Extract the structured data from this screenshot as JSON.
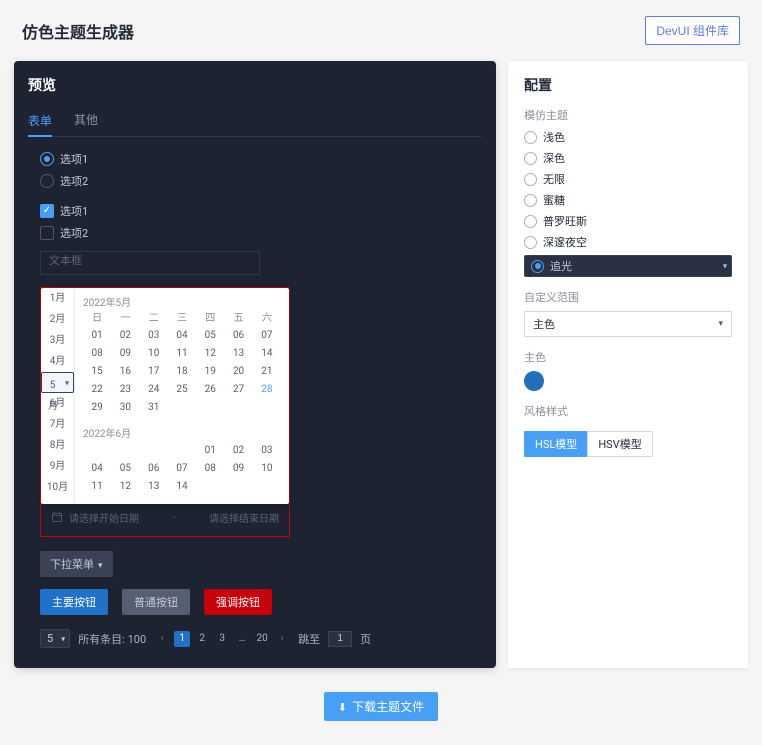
{
  "header": {
    "title": "仿色主题生成器",
    "devui_label": "DevUI 组件库"
  },
  "preview": {
    "title": "预览",
    "tabs": [
      "表单",
      "其他"
    ],
    "active_tab": 0,
    "radio_group": [
      {
        "label": "选项1",
        "checked": true
      },
      {
        "label": "选项2",
        "checked": false
      }
    ],
    "check_group": [
      {
        "label": "选项1",
        "checked": true
      },
      {
        "label": "选项2",
        "checked": false
      }
    ],
    "text_placeholder": "文本框",
    "daterange": {
      "start_placeholder": "请选择开始日期",
      "end_placeholder": "请选择结束日期",
      "sep": "-"
    },
    "calendar": {
      "months_rail": [
        "1月",
        "2月",
        "3月",
        "4月",
        "5月",
        "6月",
        "7月",
        "8月",
        "9月",
        "10月"
      ],
      "selected_month_idx": 4,
      "weekday_headers": [
        "日",
        "一",
        "二",
        "三",
        "四",
        "五",
        "六"
      ],
      "month1_title": "2022年5月",
      "month1_days": [
        1,
        2,
        3,
        4,
        5,
        6,
        7,
        8,
        9,
        10,
        11,
        12,
        13,
        14,
        15,
        16,
        17,
        18,
        19,
        20,
        21,
        22,
        23,
        24,
        25,
        26,
        27,
        28,
        29,
        30,
        31
      ],
      "month1_highlight": 28,
      "month2_title": "2022年6月",
      "month2_days": [
        "",
        "",
        "",
        "",
        1,
        2,
        3,
        4,
        5,
        6,
        7,
        8,
        9,
        10,
        11,
        12,
        13,
        14
      ]
    },
    "dropdown_btn": "下拉菜单",
    "buttons": {
      "primary": "主要按钮",
      "normal": "普通按钮",
      "danger": "强调按钮"
    },
    "pager": {
      "page_size_sel": "5",
      "total_label": "所有条目: 100",
      "pages": [
        "1",
        "2",
        "3",
        "…",
        "20"
      ],
      "active_idx": 0,
      "jump_label": "跳至",
      "jump_val": "1",
      "jump_suffix": "页"
    }
  },
  "config": {
    "title": "配置",
    "theme_label": "模仿主题",
    "themes": [
      "浅色",
      "深色",
      "无限",
      "蜜糖",
      "普罗旺斯",
      "深邃夜空",
      "追光"
    ],
    "selected_theme_idx": 6,
    "custom_scope_label": "自定义范围",
    "custom_scope_value": "主色",
    "color_label": "主色",
    "color_hex": "#2170bd",
    "style_label": "风格样式",
    "style_options": [
      "HSL模型",
      "HSV模型"
    ],
    "style_active_idx": 0
  },
  "footer": {
    "download_label": "下载主题文件"
  }
}
